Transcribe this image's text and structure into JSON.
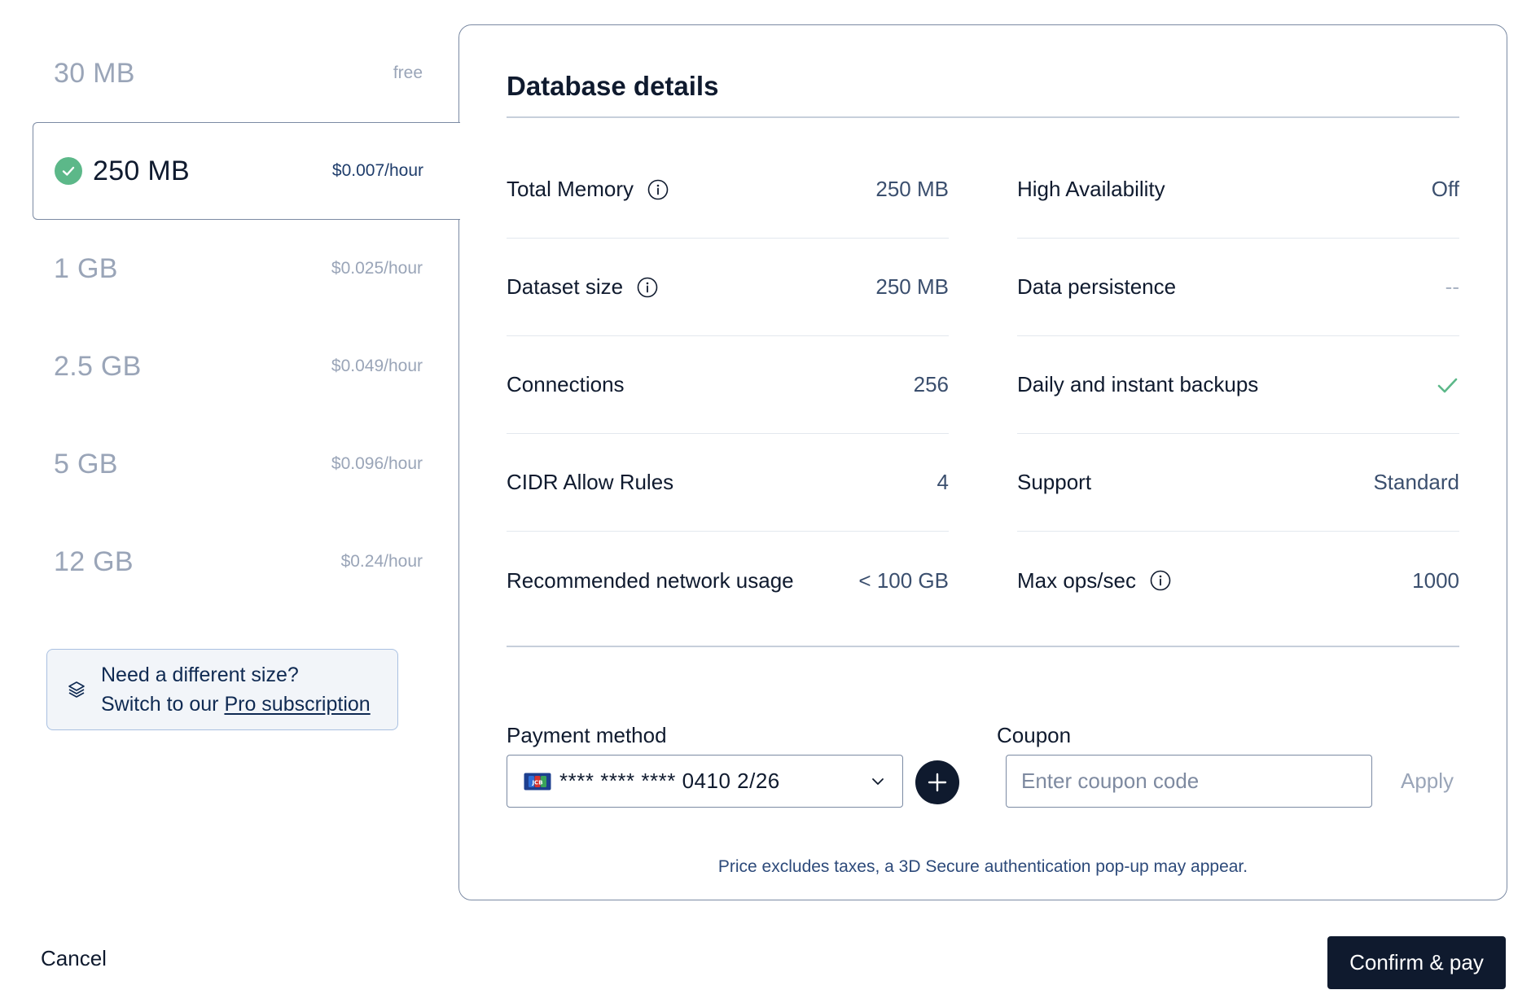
{
  "plans": [
    {
      "size": "30 MB",
      "price": "free",
      "selected": false
    },
    {
      "size": "250 MB",
      "price": "$0.007/hour",
      "selected": true
    },
    {
      "size": "1 GB",
      "price": "$0.025/hour",
      "selected": false
    },
    {
      "size": "2.5 GB",
      "price": "$0.049/hour",
      "selected": false
    },
    {
      "size": "5 GB",
      "price": "$0.096/hour",
      "selected": false
    },
    {
      "size": "12 GB",
      "price": "$0.24/hour",
      "selected": false
    }
  ],
  "pro_banner": {
    "line1": "Need a different size?",
    "line2_prefix": "Switch to our ",
    "link": "Pro subscription",
    "icon": "layers-icon"
  },
  "details": {
    "title": "Database details",
    "left": [
      {
        "label": "Total Memory",
        "value": "250 MB",
        "info": true
      },
      {
        "label": "Dataset size",
        "value": "250 MB",
        "info": true
      },
      {
        "label": "Connections",
        "value": "256",
        "info": false
      },
      {
        "label": "CIDR Allow Rules",
        "value": "4",
        "info": false
      },
      {
        "label": "Recommended network usage",
        "value": "< 100 GB",
        "info": false
      }
    ],
    "right": [
      {
        "label": "High Availability",
        "value": "Off",
        "info": false
      },
      {
        "label": "Data persistence",
        "value": "--",
        "info": false
      },
      {
        "label": "Daily and instant backups",
        "value": "",
        "icon": "check-icon",
        "info": false
      },
      {
        "label": "Support",
        "value": "Standard",
        "info": false
      },
      {
        "label": "Max ops/sec",
        "value": "1000",
        "info": true
      }
    ]
  },
  "payment": {
    "label": "Payment method",
    "card_masked": "**** **** **** 0410 2/26",
    "card_brand_icon": "jcb-card-icon",
    "add_icon": "plus-icon"
  },
  "coupon": {
    "label": "Coupon",
    "placeholder": "Enter coupon code",
    "value": "",
    "apply_label": "Apply"
  },
  "disclaimer": "Price excludes taxes, a 3D Secure authentication pop-up may appear.",
  "footer": {
    "cancel_label": "Cancel",
    "confirm_label": "Confirm & pay"
  },
  "colors": {
    "accent_dark": "#0f1a2e",
    "check_green": "#5cb889",
    "muted": "#9aa5b8"
  }
}
